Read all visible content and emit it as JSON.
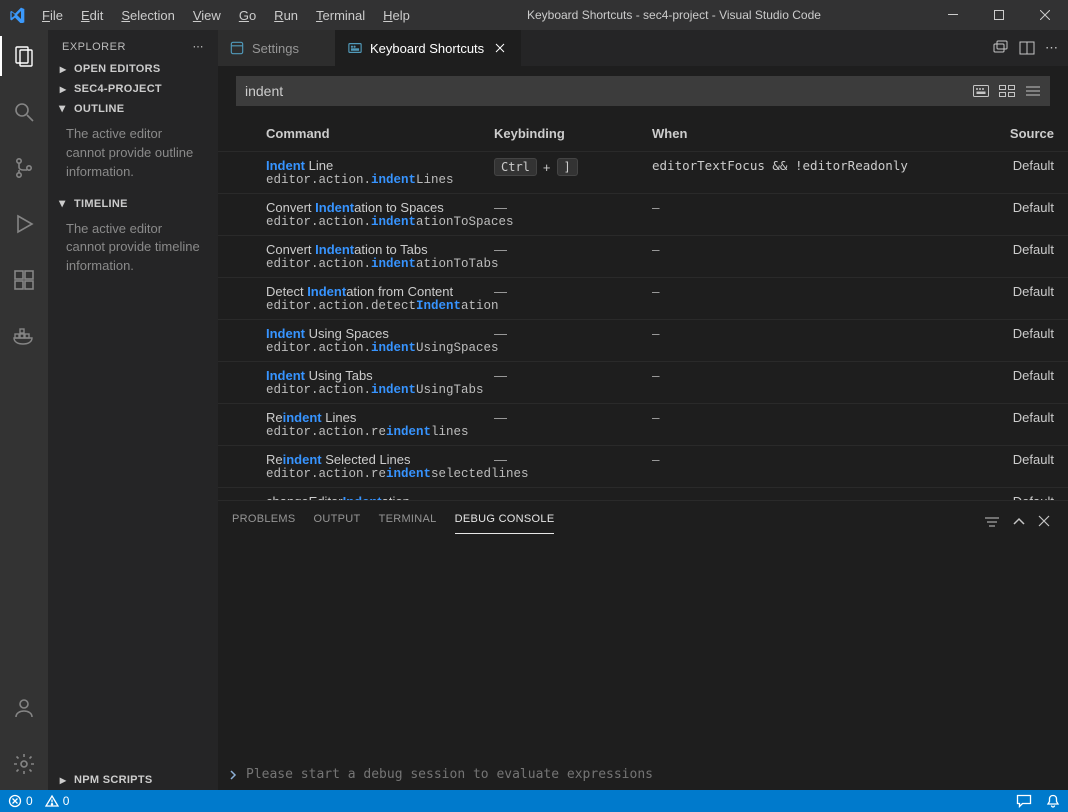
{
  "title": "Keyboard Shortcuts - sec4-project - Visual Studio Code",
  "menubar": [
    "File",
    "Edit",
    "Selection",
    "View",
    "Go",
    "Run",
    "Terminal",
    "Help"
  ],
  "activity": {
    "top": [
      "explorer",
      "search",
      "source-control",
      "run-debug",
      "extensions",
      "docker"
    ],
    "bottom": [
      "account",
      "settings"
    ]
  },
  "sidebar": {
    "title": "EXPLORER",
    "sections": [
      {
        "label": "OPEN EDITORS",
        "expanded": false
      },
      {
        "label": "SEC4-PROJECT",
        "expanded": false
      },
      {
        "label": "OUTLINE",
        "expanded": true,
        "body": "The active editor cannot provide outline information."
      },
      {
        "label": "TIMELINE",
        "expanded": true,
        "body": "The active editor cannot provide timeline information."
      },
      {
        "label": "NPM SCRIPTS",
        "expanded": false
      }
    ]
  },
  "tabs": [
    {
      "label": "Settings",
      "active": false
    },
    {
      "label": "Keyboard Shortcuts",
      "active": true
    }
  ],
  "search": {
    "value": "indent"
  },
  "columns": {
    "command": "Command",
    "keybinding": "Keybinding",
    "when": "When",
    "source": "Source"
  },
  "rows": [
    {
      "cmd": {
        "pre": "",
        "hl": "Indent",
        "post": " Line"
      },
      "id": {
        "pre": "editor.action.",
        "hl": "indent",
        "post": "Lines"
      },
      "keys": [
        "Ctrl",
        "]"
      ],
      "when": "editorTextFocus && !editorReadonly",
      "source": "Default"
    },
    {
      "cmd": {
        "pre": "Convert ",
        "hl": "Indent",
        "post": "ation to Spaces"
      },
      "id": {
        "pre": "editor.action.",
        "hl": "indent",
        "post": "ationToSpaces"
      },
      "when": "",
      "source": "Default"
    },
    {
      "cmd": {
        "pre": "Convert ",
        "hl": "Indent",
        "post": "ation to Tabs"
      },
      "id": {
        "pre": "editor.action.",
        "hl": "indent",
        "post": "ationToTabs"
      },
      "when": "",
      "source": "Default"
    },
    {
      "cmd": {
        "pre": "Detect ",
        "hl": "Indent",
        "post": "ation from Content"
      },
      "id": {
        "pre": "editor.action.detect",
        "hl": "Indent",
        "post": "ation"
      },
      "when": "",
      "source": "Default"
    },
    {
      "cmd": {
        "pre": "",
        "hl": "Indent",
        "post": " Using Spaces"
      },
      "id": {
        "pre": "editor.action.",
        "hl": "indent",
        "post": "UsingSpaces"
      },
      "when": "",
      "source": "Default"
    },
    {
      "cmd": {
        "pre": "",
        "hl": "Indent",
        "post": " Using Tabs"
      },
      "id": {
        "pre": "editor.action.",
        "hl": "indent",
        "post": "UsingTabs"
      },
      "when": "",
      "source": "Default"
    },
    {
      "cmd": {
        "pre": "Re",
        "hl": "indent",
        "post": " Lines"
      },
      "id": {
        "pre": "editor.action.re",
        "hl": "indent",
        "post": "lines"
      },
      "when": "",
      "source": "Default"
    },
    {
      "cmd": {
        "pre": "Re",
        "hl": "indent",
        "post": " Selected Lines"
      },
      "id": {
        "pre": "editor.action.re",
        "hl": "indent",
        "post": "selectedlines"
      },
      "when": "",
      "source": "Default"
    },
    {
      "cmd": {
        "pre": "changeEditor",
        "hl": "Indent",
        "post": "ation"
      },
      "id": null,
      "when": "",
      "source": "Default"
    }
  ],
  "panel": {
    "tabs": [
      "PROBLEMS",
      "OUTPUT",
      "TERMINAL",
      "DEBUG CONSOLE"
    ],
    "activeTab": "DEBUG CONSOLE",
    "placeholder": "Please start a debug session to evaluate expressions"
  },
  "status": {
    "errors": "0",
    "warnings": "0"
  }
}
